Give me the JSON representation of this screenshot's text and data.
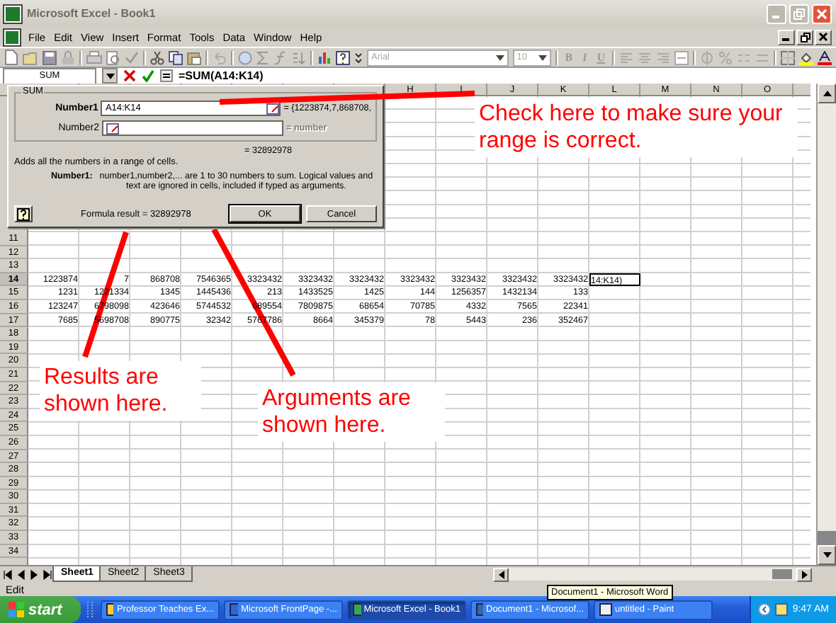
{
  "window": {
    "title": "Microsoft Excel - Book1"
  },
  "menu": [
    "File",
    "Edit",
    "View",
    "Insert",
    "Format",
    "Tools",
    "Data",
    "Window",
    "Help"
  ],
  "toolbar": {
    "font": "Arial",
    "size": "10",
    "format_buttons": [
      "B",
      "I",
      "U"
    ]
  },
  "formula_bar": {
    "name_box": "SUM",
    "formula": "=SUM(A14:K14)"
  },
  "sheet": {
    "columns": [
      "",
      "",
      "",
      "",
      "",
      "",
      "",
      "H",
      "I",
      "J",
      "K",
      "L",
      "M",
      "N",
      "O"
    ],
    "rows": [
      {
        "number": "11",
        "cells": []
      },
      {
        "number": "12",
        "cells": []
      },
      {
        "number": "13",
        "cells": []
      },
      {
        "number": "14",
        "cells": [
          "1223874",
          "7",
          "868708",
          "7546365",
          "3323432",
          "3323432",
          "3323432",
          "3323432",
          "3323432",
          "3323432",
          "3323432"
        ],
        "editing": "14:K14)"
      },
      {
        "number": "15",
        "cells": [
          "1231",
          "1221334",
          "1345",
          "1445436",
          "213",
          "1433525",
          "1425",
          "144",
          "1256357",
          "1432134",
          "133"
        ]
      },
      {
        "number": "16",
        "cells": [
          "123247",
          "6798098",
          "423646",
          "5744532",
          "689554",
          "7809875",
          "68654",
          "70785",
          "4332",
          "7565",
          "22341"
        ]
      },
      {
        "number": "17",
        "cells": [
          "7685",
          "5698708",
          "890775",
          "32342",
          "5767786",
          "8664",
          "345379",
          "78",
          "5443",
          "236",
          "352467"
        ]
      },
      {
        "number": "18",
        "cells": []
      },
      {
        "number": "19",
        "cells": []
      },
      {
        "number": "20",
        "cells": []
      },
      {
        "number": "21",
        "cells": []
      },
      {
        "number": "22",
        "cells": []
      },
      {
        "number": "23",
        "cells": []
      },
      {
        "number": "24",
        "cells": []
      },
      {
        "number": "25",
        "cells": []
      },
      {
        "number": "26",
        "cells": []
      },
      {
        "number": "27",
        "cells": []
      },
      {
        "number": "28",
        "cells": []
      },
      {
        "number": "29",
        "cells": []
      },
      {
        "number": "30",
        "cells": []
      },
      {
        "number": "31",
        "cells": []
      },
      {
        "number": "32",
        "cells": []
      },
      {
        "number": "33",
        "cells": []
      },
      {
        "number": "34",
        "cells": []
      }
    ]
  },
  "dialog": {
    "group": "SUM",
    "args": [
      {
        "label": "Number1",
        "value": "A14:K14",
        "result": "= {1223874,7,868708,",
        "active": true
      },
      {
        "label": "Number2",
        "result": "= number",
        "active": false
      }
    ],
    "total": "= 32892978",
    "description": "Adds all the numbers in a range of cells.",
    "help_label": "Number1:",
    "help_text": "number1,number2,... are 1 to 30 numbers to sum. Logical values and text are ignored in cells, included if typed as arguments.",
    "formula_result": "Formula result = 32892978",
    "buttons": [
      "OK",
      "Cancel"
    ]
  },
  "callouts": [
    "Check here to make sure your range is correct.",
    "Results are shown here.",
    "Arguments are shown here."
  ],
  "sheet_tabs": [
    {
      "label": "Sheet1",
      "selected": true
    },
    {
      "label": "Sheet2",
      "selected": false
    },
    {
      "label": "Sheet3",
      "selected": false
    }
  ],
  "status_bar": {
    "mode": "Edit",
    "tooltip": "Document1 - Microsoft Word"
  },
  "taskbar": {
    "start": "start",
    "tasks": [
      {
        "label": "Professor Teaches Ex...",
        "selected": false
      },
      {
        "label": "Microsoft FrontPage -...",
        "selected": false
      },
      {
        "label": "Microsoft Excel - Book1",
        "selected": true
      },
      {
        "label": "Document1 - Microsof...",
        "selected": false
      },
      {
        "label": "untitled - Paint",
        "selected": false
      }
    ],
    "clock": "9:47 AM"
  }
}
